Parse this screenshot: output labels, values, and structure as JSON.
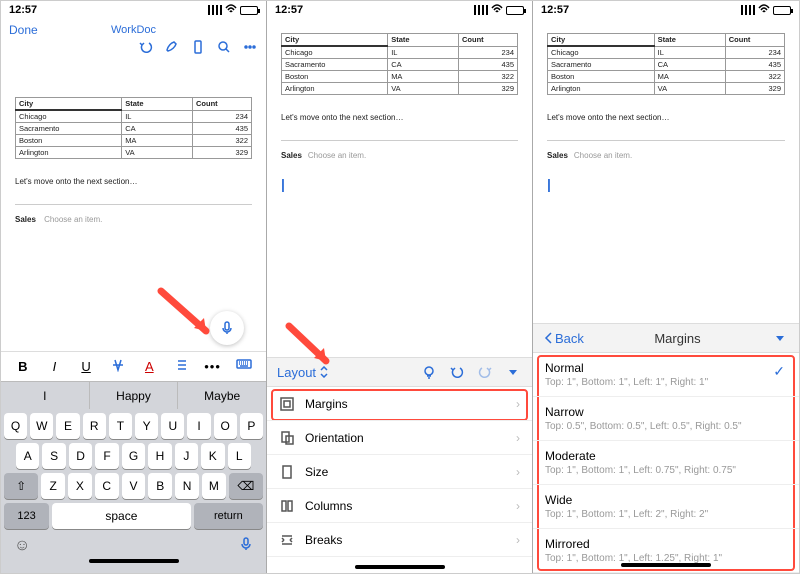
{
  "status": {
    "time": "12:57"
  },
  "pane1": {
    "done": "Done",
    "title": "WorkDoc",
    "toolbar_icons": [
      "undo",
      "pen",
      "phone",
      "search",
      "more"
    ],
    "predictions": [
      "I",
      "Happy",
      "Maybe"
    ],
    "fmt_labels": [
      "B",
      "I",
      "U",
      "strike",
      "Afont",
      "list",
      "more",
      "kbd"
    ],
    "keyboard": {
      "row1": [
        "Q",
        "W",
        "E",
        "R",
        "T",
        "Y",
        "U",
        "I",
        "O",
        "P"
      ],
      "row2": [
        "A",
        "S",
        "D",
        "F",
        "G",
        "H",
        "J",
        "K",
        "L"
      ],
      "row3_shift": "⇧",
      "row3": [
        "Z",
        "X",
        "C",
        "V",
        "B",
        "N",
        "M"
      ],
      "row3_bksp": "⌫",
      "num": "123",
      "space": "space",
      "return": "return"
    }
  },
  "document": {
    "table": {
      "headers": [
        "City",
        "State",
        "Count"
      ],
      "rows": [
        [
          "Chicago",
          "IL",
          "234"
        ],
        [
          "Sacramento",
          "CA",
          "435"
        ],
        [
          "Boston",
          "MA",
          "322"
        ],
        [
          "Arlington",
          "VA",
          "329"
        ]
      ]
    },
    "para": "Let's move onto the next section…",
    "sales_label": "Sales",
    "sales_hint": "Choose an item."
  },
  "pane2": {
    "ribbon_label": "Layout",
    "menu": [
      {
        "icon": "margins",
        "label": "Margins"
      },
      {
        "icon": "orientation",
        "label": "Orientation"
      },
      {
        "icon": "size",
        "label": "Size"
      },
      {
        "icon": "columns",
        "label": "Columns"
      },
      {
        "icon": "breaks",
        "label": "Breaks"
      }
    ]
  },
  "pane3": {
    "back": "Back",
    "title": "Margins",
    "options": [
      {
        "name": "Normal",
        "desc": "Top: 1\", Bottom: 1\", Left: 1\", Right: 1\"",
        "selected": true
      },
      {
        "name": "Narrow",
        "desc": "Top: 0.5\", Bottom: 0.5\", Left: 0.5\", Right: 0.5\""
      },
      {
        "name": "Moderate",
        "desc": "Top: 1\", Bottom: 1\", Left: 0.75\", Right: 0.75\""
      },
      {
        "name": "Wide",
        "desc": "Top: 1\", Bottom: 1\", Left: 2\", Right: 2\""
      },
      {
        "name": "Mirrored",
        "desc": "Top: 1\", Bottom: 1\", Left: 1.25\", Right: 1\""
      }
    ]
  }
}
